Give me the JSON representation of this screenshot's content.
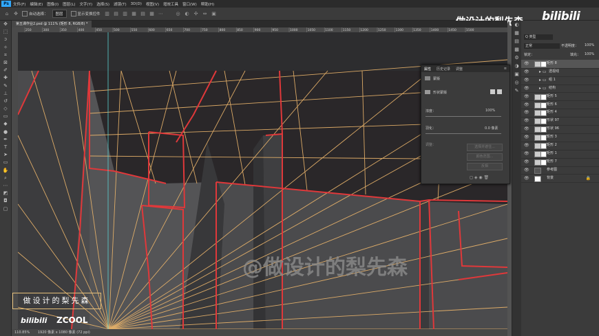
{
  "app": {
    "logo": "Ps"
  },
  "menu": [
    "文件(F)",
    "编辑(E)",
    "图像(I)",
    "图层(L)",
    "文字(Y)",
    "选择(S)",
    "滤镜(T)",
    "3D(D)",
    "视图(V)",
    "增效工具",
    "窗口(W)",
    "帮助(H)"
  ],
  "options": {
    "auto_select_label": "自动选择：",
    "auto_select_value": "图层",
    "transform_label": "显示变换控件"
  },
  "tools": [
    "move-icon",
    "marquee-icon",
    "lasso-icon",
    "magic-wand-icon",
    "crop-icon",
    "frame-icon",
    "eyedropper-icon",
    "healing-icon",
    "brush-icon",
    "stamp-icon",
    "history-brush-icon",
    "eraser-icon",
    "gradient-icon",
    "blur-icon",
    "dodge-icon",
    "pen-icon",
    "type-icon",
    "path-select-icon",
    "shape-icon",
    "hand-icon",
    "zoom-icon",
    "more-icon",
    "colors-icon",
    "mask-icon",
    "screen-mode-icon"
  ],
  "document": {
    "tab_title": "第五课作业2.psd @ 111% (矩形 8, RGB/8) *",
    "zoom": "110.85%",
    "doc_info": "1920 像素 x 1080 像素 (72 ppi)"
  },
  "ruler_ticks": [
    "250",
    "300",
    "350",
    "400",
    "450",
    "500",
    "550",
    "600",
    "650",
    "700",
    "750",
    "800",
    "850",
    "900",
    "950",
    "1000",
    "1050",
    "1100",
    "1150",
    "1200",
    "1250",
    "1300",
    "1350",
    "1400",
    "1450",
    "1500"
  ],
  "properties": {
    "tabs": [
      "属性",
      "历史记录",
      "调整"
    ],
    "section": "蒙版",
    "subsection": "形状蒙版",
    "density_label": "浓度：",
    "density_value": "100%",
    "feather_label": "羽化：",
    "feather_value": "0.0 像素",
    "refine_label": "调整：",
    "btn_select": "选择并遮住...",
    "btn_color": "颜色范围...",
    "btn_invert": "反相"
  },
  "layers": {
    "filter_label": "Q 类型",
    "blend_mode": "正常",
    "opacity_label": "不透明度：",
    "opacity_value": "100%",
    "lock_label": "锁定：",
    "fill_label": "填充：",
    "fill_value": "100%",
    "items": [
      {
        "name": "矩形 8",
        "selected": true,
        "type": "shape"
      },
      {
        "name": "透视线",
        "selected": false,
        "type": "group"
      },
      {
        "name": "组 1",
        "selected": false,
        "type": "group"
      },
      {
        "name": "结构",
        "selected": false,
        "type": "group"
      },
      {
        "name": "矩形 5",
        "selected": false,
        "type": "shape"
      },
      {
        "name": "矩形 6",
        "selected": false,
        "type": "shape"
      },
      {
        "name": "矩形 4",
        "selected": false,
        "type": "shape"
      },
      {
        "name": "形状 97",
        "selected": false,
        "type": "shape"
      },
      {
        "name": "形状 96",
        "selected": false,
        "type": "shape"
      },
      {
        "name": "矩形 3",
        "selected": false,
        "type": "shape"
      },
      {
        "name": "矩形 2",
        "selected": false,
        "type": "shape"
      },
      {
        "name": "矩形 1",
        "selected": false,
        "type": "shape"
      },
      {
        "name": "矩形 7",
        "selected": false,
        "type": "shape"
      },
      {
        "name": "参考图",
        "selected": false,
        "type": "image"
      },
      {
        "name": "背景",
        "selected": false,
        "type": "background"
      }
    ]
  },
  "overlay": {
    "channel_logo": "bilibili",
    "channel_name": "做设计的梨先森",
    "watermark": "@做设计的梨先森",
    "name_box": "做设计的梨先森",
    "bottom_bili": "bilibili",
    "bottom_zcool": "ZCOOL"
  },
  "colors": {
    "accent": "#31a8ff",
    "guide": "#e7b26a",
    "structure": "#e0383a",
    "wall": "#4d4d4f",
    "ceiling": "#2b292c"
  }
}
